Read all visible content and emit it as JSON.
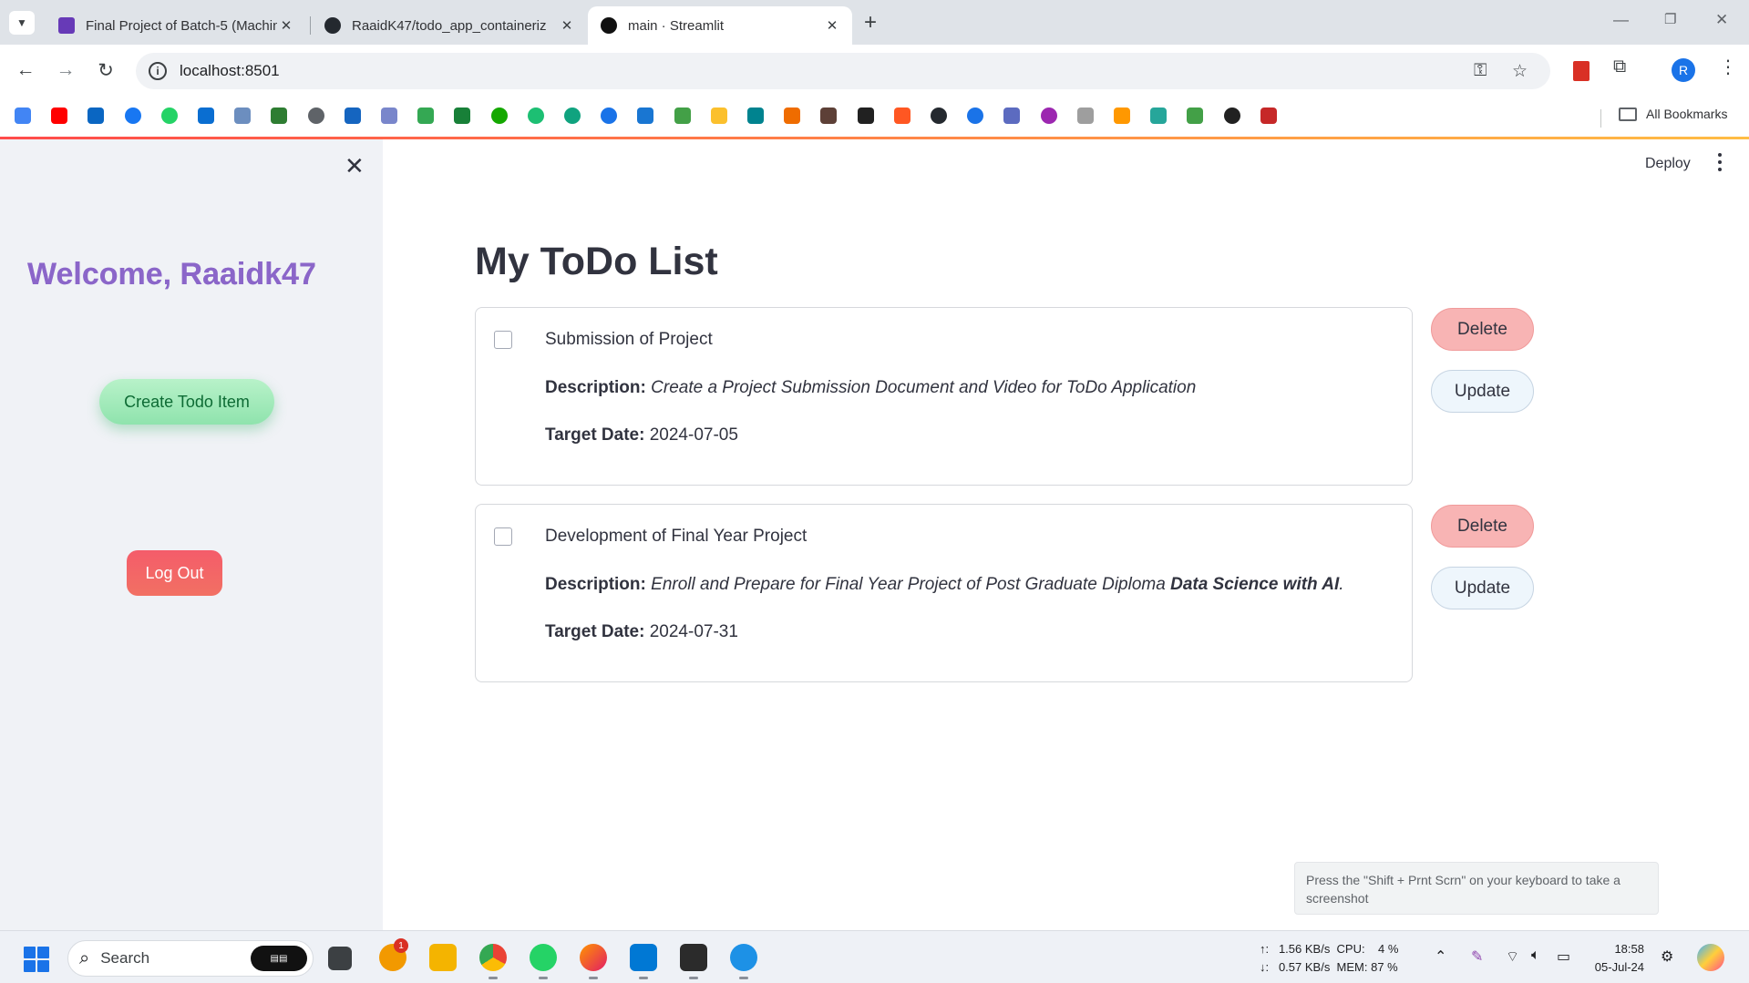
{
  "browser": {
    "tabs": [
      {
        "title": "Final Project of Batch-5 (Machin",
        "favicon": "forms-icon",
        "active": false
      },
      {
        "title": "RaaidK47/todo_app_containeriz",
        "favicon": "github-icon",
        "active": false
      },
      {
        "title": "main · Streamlit",
        "favicon": "streamlit-icon",
        "active": true
      }
    ],
    "url": "localhost:8501",
    "profile_initial": "R",
    "all_bookmarks_label": "All Bookmarks",
    "bookmark_icons": [
      "google",
      "youtube",
      "linkedin",
      "facebook",
      "whatsapp",
      "sap",
      "chart",
      "tree",
      "globe",
      "saturn",
      "mail",
      "drive",
      "classroom",
      "upwork",
      "fiverr",
      "openai",
      "circle",
      "box",
      "robot",
      "emoji",
      "diamond",
      "pma",
      "helm",
      "terminal",
      "fire",
      "github",
      "cloud-c",
      "udacity",
      "hex",
      "gear",
      "package",
      "dots",
      "green",
      "crown",
      "pdf"
    ]
  },
  "sidebar": {
    "welcome": "Welcome, Raaidk47",
    "create_button": "Create Todo Item",
    "logout_button": "Log Out"
  },
  "header": {
    "deploy_label": "Deploy"
  },
  "main": {
    "title": "My ToDo List",
    "todos": [
      {
        "title": "Submission of Project",
        "description_label": "Description:",
        "description": "Create a Project Submission Document and Video for ToDo Application",
        "description_bold": "",
        "description_end": "",
        "target_label": "Target Date:",
        "target_date": "2024-07-05",
        "delete_label": "Delete",
        "update_label": "Update"
      },
      {
        "title": "Development of Final Year Project",
        "description_label": "Description:",
        "description": "Enroll and Prepare for Final Year Project of Post Graduate Diploma ",
        "description_bold": "Data Science with AI",
        "description_end": ".",
        "target_label": "Target Date:",
        "target_date": "2024-07-31",
        "delete_label": "Delete",
        "update_label": "Update"
      }
    ]
  },
  "tooltip": {
    "text": "Press the \"Shift + Prnt Scrn\" on your keyboard to take a screenshot"
  },
  "taskbar": {
    "search_label": "Search",
    "notification_count": "1",
    "network": "↑:   1.56 KB/s  CPU:    4 %\n↓:   0.57 KB/s  MEM: 87 %",
    "time": "18:58",
    "date": "05-Jul-24"
  },
  "colors": {
    "sidebar_bg": "#f0f2f6",
    "delete_bg": "#f8b4b4",
    "update_bg": "#eef6fc",
    "create_bg": "#a6ecbd",
    "logout_bg": "#f45c6a",
    "welcome": "#8b66c9"
  }
}
